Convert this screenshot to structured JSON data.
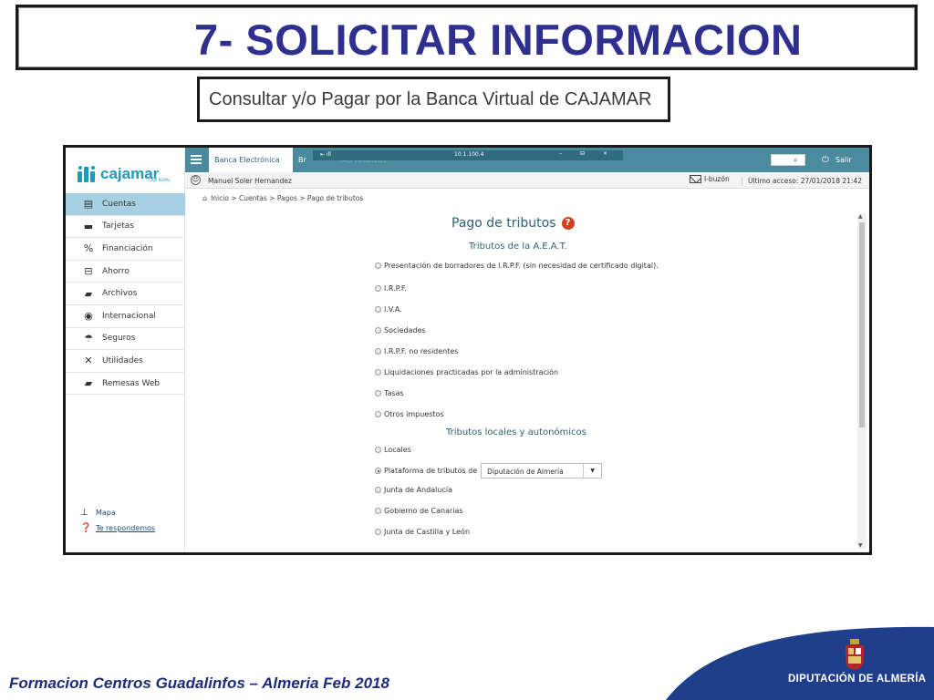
{
  "slide": {
    "title": "7- SOLICITAR INFORMACION",
    "subtitle": "Consultar y/o Pagar por la Banca Virtual de CAJAMAR",
    "footer": "Formacion Centros Guadalinfos – Almeria Feb 2018",
    "brand": "DIPUTACIÓN DE ALMERÍA"
  },
  "app": {
    "logo_text": "cajamar",
    "logo_sub": "CAJA RURAL",
    "topbar": {
      "tab_active": "Banca Electrónica",
      "tab_2": "Br",
      "tab_3": "Mis Finanzas",
      "remote_left": "⇤ ıll",
      "remote_center": "10.1.100.4",
      "remote_right": "– ⊟ ×",
      "salir": "Salir"
    },
    "userbar": {
      "user_name": "Manuel Soler Hernandez",
      "ibuzon": "I-buzón",
      "ultimo_acceso": "Último acceso: 27/01/2018 21:42"
    },
    "sidebar": {
      "items": [
        {
          "label": "Cuentas",
          "icon": "accounts-icon",
          "glyph": "▤",
          "active": true
        },
        {
          "label": "Tarjetas",
          "icon": "card-icon",
          "glyph": "▬",
          "active": false
        },
        {
          "label": "Financiación",
          "icon": "percent-icon",
          "glyph": "%",
          "active": false
        },
        {
          "label": "Ahorro",
          "icon": "savings-icon",
          "glyph": "⊟",
          "active": false
        },
        {
          "label": "Archivos",
          "icon": "folder-icon",
          "glyph": "▰",
          "active": false
        },
        {
          "label": "Internacional",
          "icon": "globe-icon",
          "glyph": "◉",
          "active": false
        },
        {
          "label": "Seguros",
          "icon": "umbrella-icon",
          "glyph": "☂",
          "active": false
        },
        {
          "label": "Utilidades",
          "icon": "tools-icon",
          "glyph": "✕",
          "active": false
        },
        {
          "label": "Remesas Web",
          "icon": "folder-icon",
          "glyph": "▰",
          "active": false
        }
      ],
      "links": [
        {
          "label": "Mapa",
          "icon": "sitemap-icon",
          "glyph": "⊥"
        },
        {
          "label": "Te respondemos",
          "icon": "chat-icon",
          "glyph": "❓"
        }
      ]
    },
    "breadcrumb": "Inicio > Cuentas > Pagos > Pago de tributos",
    "page_title": "Pago de tributos",
    "section_aeat": "Tributos de la A.E.A.T.",
    "section_locales": "Tributos locales y autonómicos",
    "options_aeat": [
      "Presentación de borradores de I.R.P.F. (sin necesidad de certificado digital).",
      "I.R.P.F.",
      "I.V.A.",
      "Sociedades",
      "I.R.P.F. no residentes",
      "Liquidaciones practicadas por la administración",
      "Tasas",
      "Otros impuestos"
    ],
    "options_locales": {
      "locales": "Locales",
      "plataforma": "Plataforma de tributos de",
      "plataforma_select": "Diputación de Almería",
      "andalucia": "Junta de Andalucía",
      "canarias": "Gobierno de Canarias",
      "castilla": "Junta de Castilla y León"
    }
  }
}
